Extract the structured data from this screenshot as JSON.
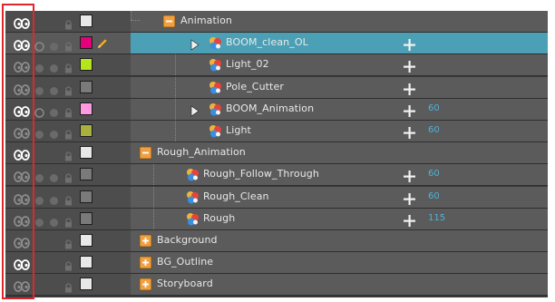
{
  "rows": [
    {
      "label": "Animation",
      "type": "group",
      "eye": true,
      "extras": false,
      "color": "#e8e8e8",
      "pencil": false,
      "plus": false,
      "value": "",
      "indent": 0,
      "triangle": false
    },
    {
      "label": "BOOM_clean_OL",
      "type": "drawing",
      "eye": true,
      "extras": true,
      "color": "#e4007a",
      "pencil": true,
      "plus": true,
      "value": "",
      "indent": 1,
      "triangle": true,
      "selected": true
    },
    {
      "label": "Light_02",
      "type": "drawing",
      "eye": false,
      "extras": true,
      "color": "#b5e61d",
      "pencil": false,
      "plus": true,
      "value": "",
      "indent": 1,
      "triangle": false
    },
    {
      "label": "Pole_Cutter",
      "type": "drawing",
      "eye": false,
      "extras": true,
      "color": "#7a7a7a",
      "pencil": false,
      "plus": true,
      "value": "",
      "indent": 1,
      "triangle": false
    },
    {
      "label": "BOOM_Animation",
      "type": "drawing",
      "eye": true,
      "extras": true,
      "color": "#ff99e0",
      "pencil": false,
      "plus": true,
      "value": "60",
      "indent": 1,
      "triangle": true
    },
    {
      "label": "Light",
      "type": "drawing",
      "eye": false,
      "extras": true,
      "color": "#a8b040",
      "pencil": false,
      "plus": true,
      "value": "60",
      "indent": 1,
      "triangle": false
    },
    {
      "label": "Rough_Animation",
      "type": "group",
      "eye": true,
      "extras": false,
      "color": "#e8e8e8",
      "pencil": false,
      "plus": false,
      "value": "",
      "indent": 0,
      "triangle": false
    },
    {
      "label": "Rough_Follow_Through",
      "type": "drawing",
      "eye": false,
      "extras": true,
      "color": "#7a7a7a",
      "pencil": false,
      "plus": true,
      "value": "60",
      "indent": 2,
      "triangle": false
    },
    {
      "label": "Rough_Clean",
      "type": "drawing",
      "eye": false,
      "extras": true,
      "color": "#7a7a7a",
      "pencil": false,
      "plus": true,
      "value": "60",
      "indent": 2,
      "triangle": false
    },
    {
      "label": "Rough",
      "type": "drawing",
      "eye": false,
      "extras": true,
      "color": "#7a7a7a",
      "pencil": false,
      "plus": true,
      "value": "115",
      "indent": 2,
      "triangle": false
    },
    {
      "label": "Background",
      "type": "group-collapsed",
      "eye": false,
      "extras": false,
      "color": "#e8e8e8",
      "pencil": false,
      "plus": false,
      "value": "",
      "indent": 0,
      "triangle": false
    },
    {
      "label": "BG_Outline",
      "type": "group-collapsed",
      "eye": true,
      "extras": false,
      "color": "#e8e8e8",
      "pencil": false,
      "plus": false,
      "value": "",
      "indent": 0,
      "triangle": false
    },
    {
      "label": "Storyboard",
      "type": "group-collapsed",
      "eye": false,
      "extras": false,
      "color": "#e8e8e8",
      "pencil": false,
      "plus": false,
      "value": "",
      "indent": 0,
      "triangle": false
    }
  ],
  "icons": {
    "eye": "enable-eye-icon",
    "lock": "lock-icon",
    "group_open": "group-open-icon",
    "group_closed": "group-closed-icon",
    "drawing": "drawing-layer-icon",
    "add": "add-plus-icon"
  },
  "colors": {
    "selection": "#4ba0b6",
    "value_text": "#4fb3d6",
    "highlight_box": "#e0262b"
  }
}
